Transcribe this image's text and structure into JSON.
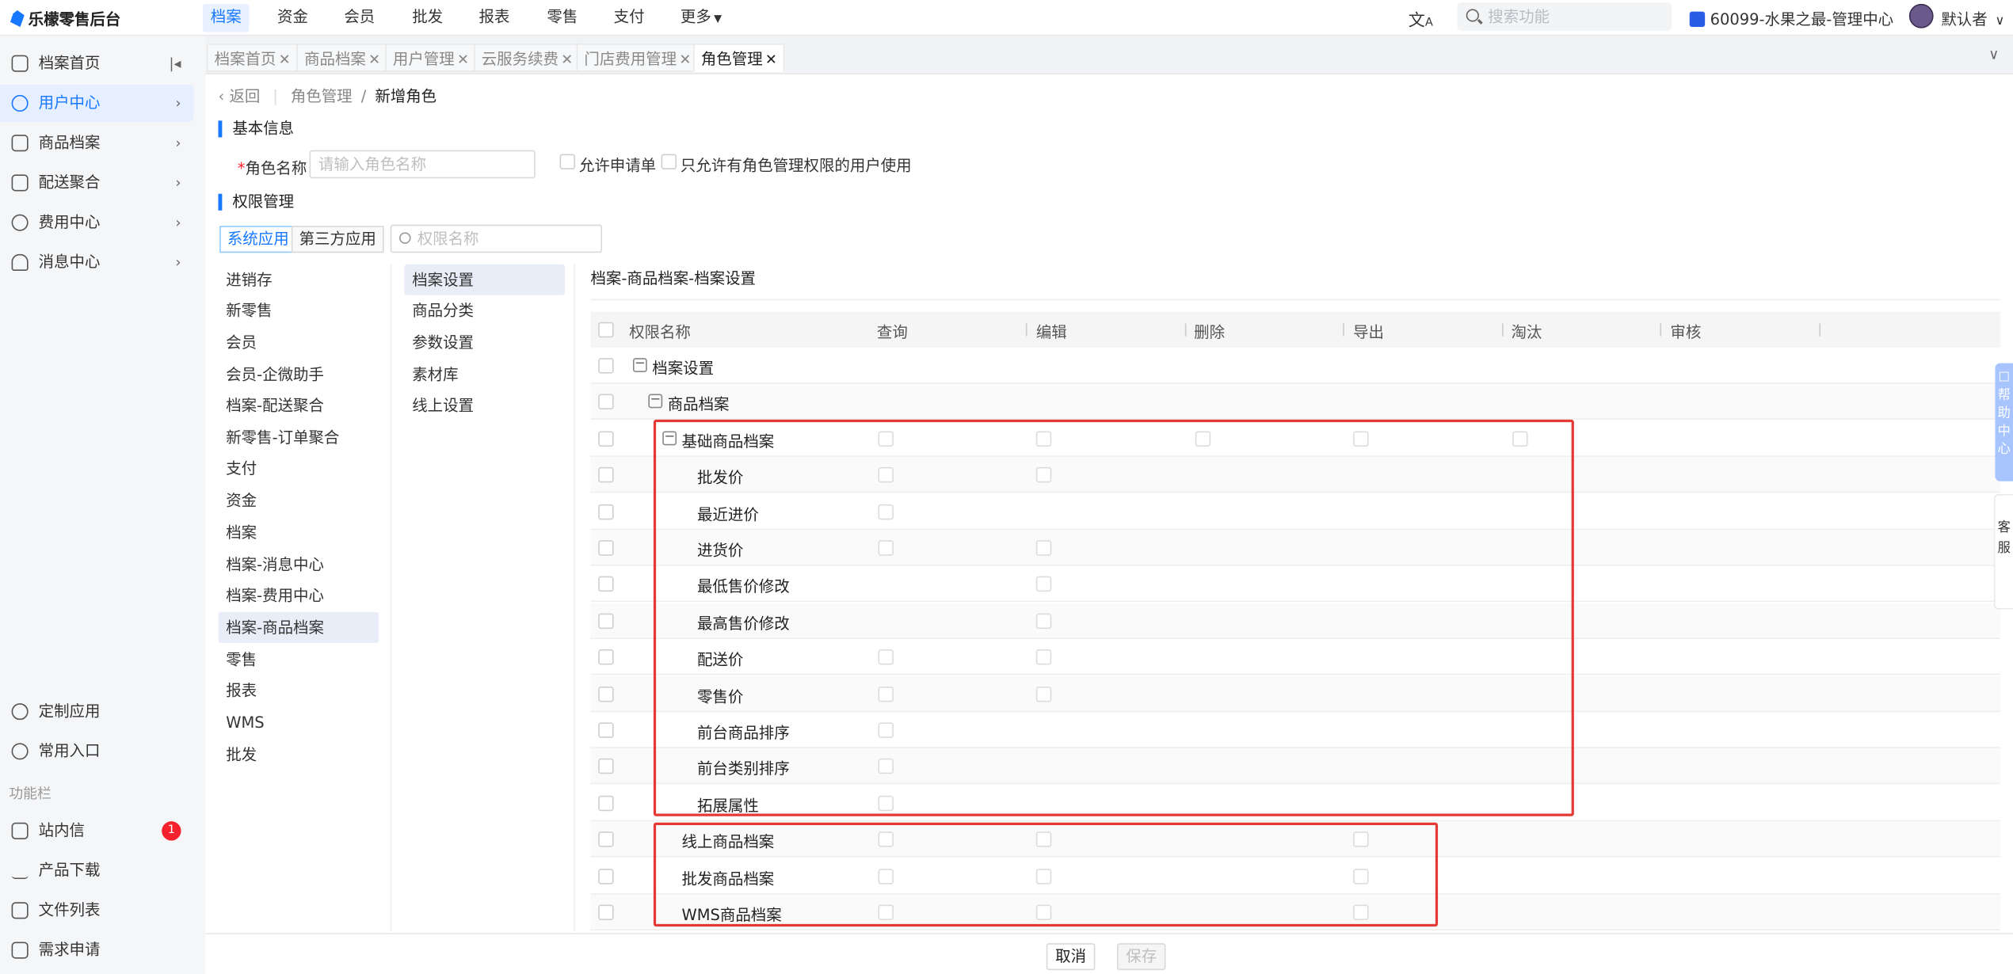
{
  "app": {
    "title": "乐檬零售后台"
  },
  "topnav": {
    "items": [
      "档案",
      "资金",
      "会员",
      "批发",
      "报表",
      "零售",
      "支付",
      "更多"
    ]
  },
  "search": {
    "placeholder": "搜索功能"
  },
  "store": {
    "label": "60099-水果之最-管理中心"
  },
  "user": {
    "name": "默认者"
  },
  "sidebar": {
    "items": [
      "档案首页",
      "用户中心",
      "商品档案",
      "配送聚合",
      "费用中心",
      "消息中心"
    ],
    "bottom": [
      "定制应用",
      "常用入口"
    ],
    "section_label": "功能栏",
    "tools": [
      "站内信",
      "产品下载",
      "文件列表",
      "需求申请"
    ],
    "badge": "1"
  },
  "tabs": [
    "档案首页",
    "商品档案",
    "用户管理",
    "云服务续费",
    "门店费用管理",
    "角色管理"
  ],
  "breadcrumb": {
    "back": "返回",
    "parent": "角色管理",
    "sep": "/",
    "current": "新增角色"
  },
  "basic": {
    "title": "基本信息",
    "required": "*",
    "role_label": "角色名称",
    "role_placeholder": "请输入角色名称",
    "allow_apply": "允许申请单",
    "admin_only": "只允许有角色管理权限的用户使用"
  },
  "perm": {
    "title": "权限管理",
    "seg": [
      "系统应用",
      "第三方应用"
    ],
    "search_placeholder": "权限名称",
    "col1": [
      "进销存",
      "新零售",
      "会员",
      "会员-企微助手",
      "档案-配送聚合",
      "新零售-订单聚合",
      "支付",
      "资金",
      "档案",
      "档案-消息中心",
      "档案-费用中心",
      "档案-商品档案",
      "零售",
      "报表",
      "WMS",
      "批发"
    ],
    "col2": [
      "档案设置",
      "商品分类",
      "参数设置",
      "素材库",
      "线上设置"
    ],
    "path": "档案-商品档案-档案设置",
    "headers": [
      "权限名称",
      "查询",
      "编辑",
      "删除",
      "导出",
      "淘汰",
      "审核"
    ],
    "rows": [
      "档案设置",
      "商品档案",
      "基础商品档案",
      "批发价",
      "最近进价",
      "进货价",
      "最低售价修改",
      "最高售价修改",
      "配送价",
      "零售价",
      "前台商品排序",
      "前台类别排序",
      "拓展属性",
      "线上商品档案",
      "批发商品档案",
      "WMS商品档案"
    ]
  },
  "footer": {
    "cancel": "取消",
    "save": "保存"
  },
  "right_tools": {
    "help": "帮助中心",
    "service": "客服"
  }
}
